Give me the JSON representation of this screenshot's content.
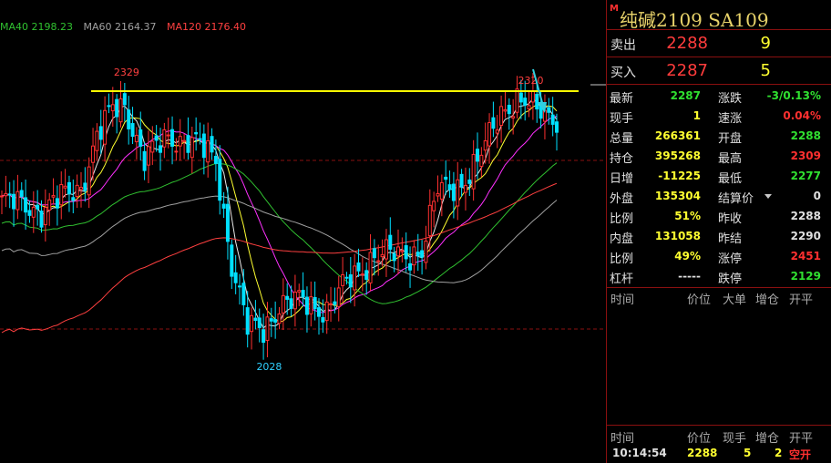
{
  "legend": [
    {
      "label": "MA40 2198.23",
      "color": "#30c030"
    },
    {
      "label": "MA60 2164.37",
      "color": "#a0a0a0"
    },
    {
      "label": "MA120 2176.40",
      "color": "#ff4040"
    }
  ],
  "colors": {
    "up": "#ff3030",
    "down": "#00e0ff",
    "yellowline": "#ffff00",
    "grid": "#8a1010",
    "ma_white": "#e8e8e8",
    "ma_yellow": "#ffff30",
    "ma_magenta": "#ff30ff",
    "ma_green": "#30c030",
    "ma_gray": "#a0a0a0",
    "ma_red": "#ff4040"
  },
  "chart_data": {
    "type": "candlestick",
    "ylim": [
      1950,
      2380
    ],
    "resistance_level": 2320,
    "annotations": [
      {
        "text": "2329",
        "value": 2329,
        "x": 31
      },
      {
        "text": "2028",
        "value": 2028,
        "x": 67
      },
      {
        "text": "2320",
        "value": 2320,
        "x": 133
      }
    ],
    "ma_series": [
      {
        "name": "MA40",
        "value": 2198.23
      },
      {
        "name": "MA60",
        "value": 2164.37
      },
      {
        "name": "MA120",
        "value": 2176.4
      }
    ]
  },
  "panel": {
    "title_mark": "M",
    "title": "纯碱2109  SA109",
    "sell": {
      "label": "卖出",
      "price": "2288",
      "vol": "9"
    },
    "buy": {
      "label": "买入",
      "price": "2287",
      "vol": "5"
    },
    "stats": [
      {
        "k1": "最新",
        "v1": "2287",
        "c1": "#30e030",
        "k2": "涨跌",
        "v2": "-3/0.13%",
        "c2": "#30e030"
      },
      {
        "k1": "现手",
        "v1": "1",
        "c1": "#ffff30",
        "k2": "速涨",
        "v2": "0.04%",
        "c2": "#ff3030"
      },
      {
        "k1": "总量",
        "v1": "266361",
        "c1": "#ffff30",
        "k2": "开盘",
        "v2": "2288",
        "c2": "#30e030"
      },
      {
        "k1": "持仓",
        "v1": "395268",
        "c1": "#ffff30",
        "k2": "最高",
        "v2": "2309",
        "c2": "#ff3030"
      },
      {
        "k1": "日增",
        "v1": "-11225",
        "c1": "#ffff30",
        "k2": "最低",
        "v2": "2277",
        "c2": "#30e030"
      },
      {
        "k1": "外盘",
        "v1": "135304",
        "c1": "#ffff30",
        "k2": "结算价",
        "v2": "0",
        "c2": "#e0e0e0"
      },
      {
        "k1": "比例",
        "v1": "51%",
        "c1": "#ffff30",
        "k2": "昨收",
        "v2": "2288",
        "c2": "#e0e0e0"
      },
      {
        "k1": "内盘",
        "v1": "131058",
        "c1": "#ffff30",
        "k2": "昨结",
        "v2": "2290",
        "c2": "#e0e0e0"
      },
      {
        "k1": "比例",
        "v1": "49%",
        "c1": "#ffff30",
        "k2": "涨停",
        "v2": "2451",
        "c2": "#ff3030"
      },
      {
        "k1": "杠杆",
        "v1": "-----",
        "c1": "#e0e0e0",
        "k2": "跌停",
        "v2": "2129",
        "c2": "#30e030"
      }
    ],
    "hdr1": {
      "time": "时间",
      "price": "价位",
      "big": "大单",
      "add": "增仓",
      "open": "开平"
    },
    "hdr2": {
      "time": "时间",
      "price": "价位",
      "hand": "现手",
      "add": "增仓",
      "open": "开平"
    },
    "tick": {
      "time": "10:14:54",
      "price": "2288",
      "hand": "5",
      "add": "2",
      "open": "空开"
    }
  }
}
